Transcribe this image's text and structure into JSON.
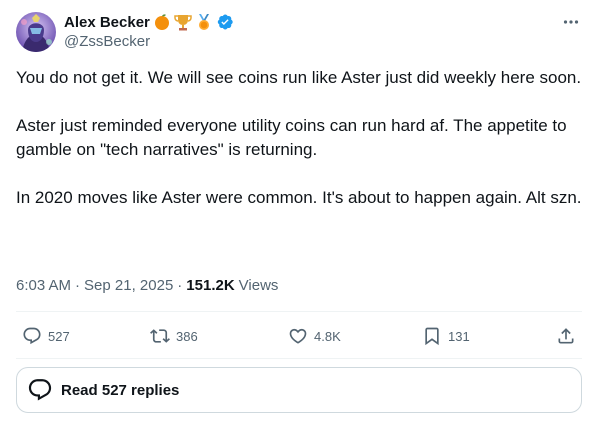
{
  "author": {
    "name": "Alex Becker",
    "handle": "@ZssBecker",
    "badges": [
      "orange-emoji",
      "trophy-emoji",
      "medal-emoji",
      "verified-badge"
    ]
  },
  "tweet": {
    "paragraphs": [
      "You do not get it. We will see coins run like Aster just did weekly here soon.",
      "Aster just reminded everyone utility coins can run hard af. The appetite to gamble on \"tech narratives\" is returning.",
      "In 2020 moves like Aster were common. It's about to happen again. Alt szn."
    ],
    "time": "6:03 AM",
    "date": "Sep 21, 2025",
    "views_count": "151.2K",
    "views_label": "Views"
  },
  "actions": {
    "replies": "527",
    "reposts": "386",
    "likes": "4.8K",
    "bookmarks": "131"
  },
  "read_replies": "Read 527 replies",
  "colors": {
    "text": "#0f1419",
    "secondary": "#536471",
    "verified": "#1d9bf0",
    "border": "#cfd9de"
  }
}
